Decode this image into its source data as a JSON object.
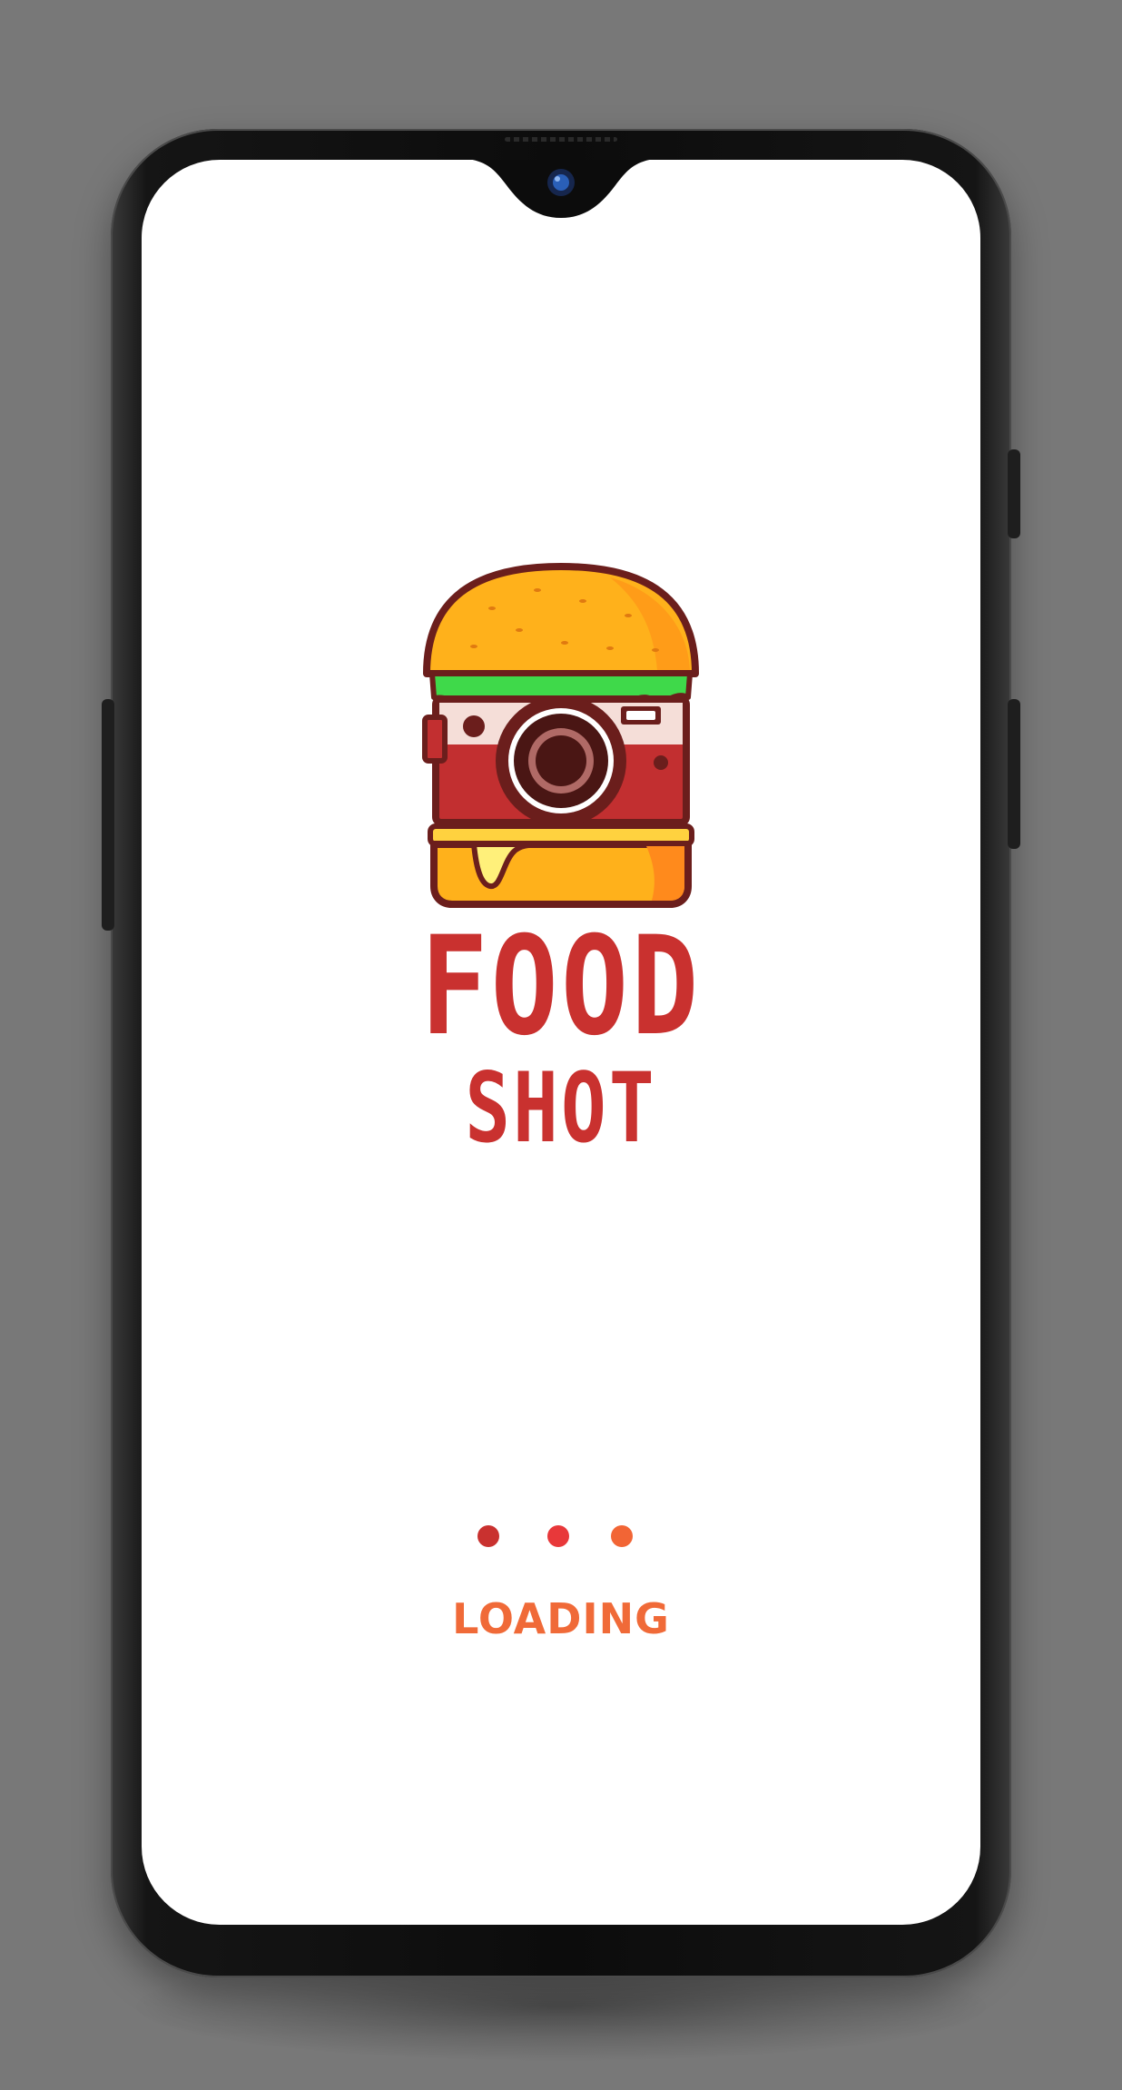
{
  "app": {
    "title_line1": "FOOD",
    "title_line2": "SHOT",
    "loading_label": "LOADING"
  },
  "logo": {
    "icon": "burger-camera-logo"
  },
  "loading_dots": {
    "count": 3,
    "colors": [
      "#c9312f",
      "#e8383a",
      "#f26535"
    ]
  },
  "colors": {
    "background": "#787878",
    "screen": "#ffffff",
    "brand": "#c9312f",
    "loading_text": "#f06a38",
    "bun": "#ffb11b",
    "lettuce": "#3fd94a",
    "camera_body": "#c22f30",
    "outline": "#6b1e1c"
  }
}
